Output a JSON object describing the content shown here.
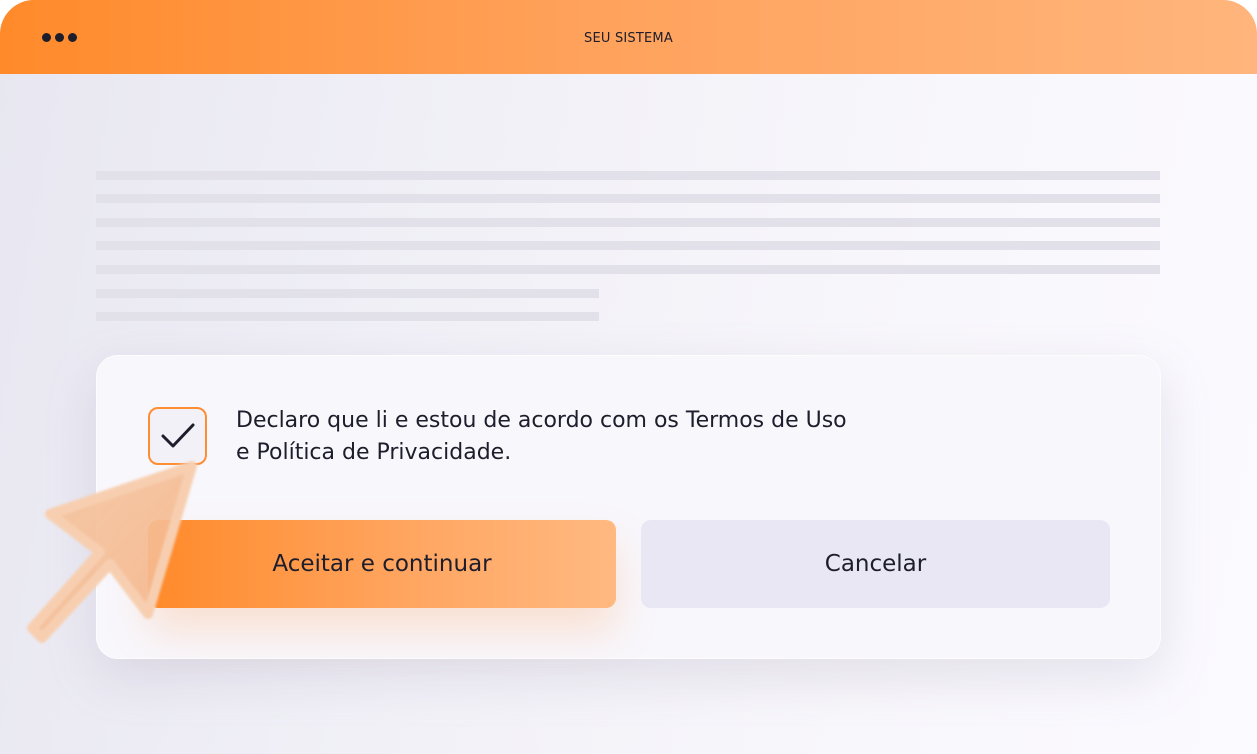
{
  "window": {
    "title": "SEU SISTEMA",
    "menu_icon": "more-horizontal-icon"
  },
  "dialog": {
    "consent_line1": "Declaro que li e estou de acordo com os Termos de Uso",
    "consent_line2": "e Política de Privacidade.",
    "checkbox_checked": true,
    "checkbox_icon": "check-icon",
    "accept_label": "Aceitar e continuar",
    "cancel_label": "Cancelar"
  },
  "colors": {
    "accent": "#ff8a2a",
    "accent_light": "#ffb981",
    "text": "#1d1d2b",
    "cancel_bg": "#e8e7f3"
  },
  "cursor_icon": "mouse-pointer-icon"
}
